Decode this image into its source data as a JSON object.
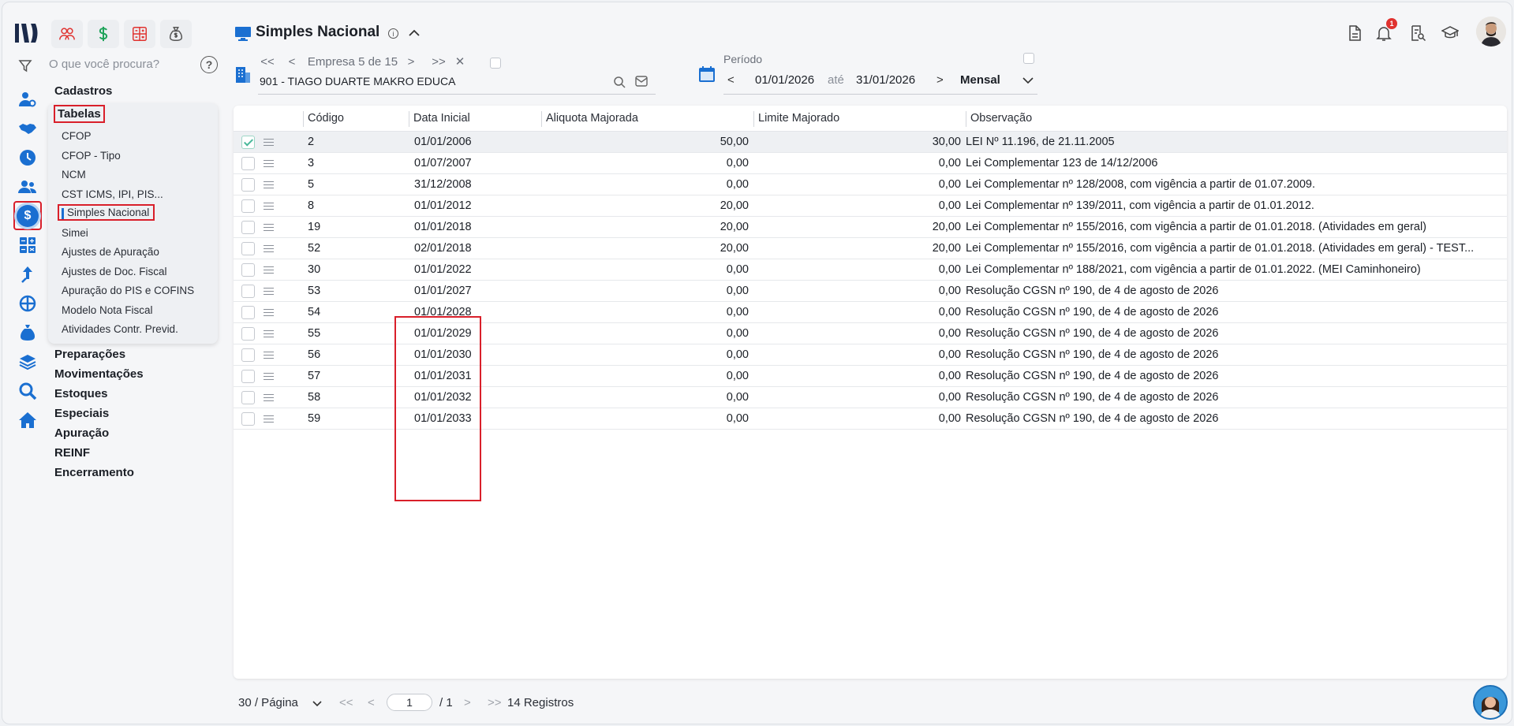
{
  "header": {
    "title": "Simples Nacional",
    "info_icon": "info-icon",
    "collapse_icon": "chevron-up-icon"
  },
  "search": {
    "placeholder": "O que você procura?"
  },
  "modules": [
    "users-icon",
    "dollar-icon",
    "calculator-icon",
    "money-bag-icon"
  ],
  "rail_icons": [
    "user-settings-icon",
    "handshake-icon",
    "clock-icon",
    "people-icon",
    "dollar-circle-icon",
    "grid-icon",
    "arrow-up-icon",
    "network-icon",
    "money-bag-icon",
    "layers-icon",
    "search-icon",
    "home-icon"
  ],
  "menu": {
    "cadastros": "Cadastros",
    "tabelas": "Tabelas",
    "items": [
      "CFOP",
      "CFOP - Tipo",
      "NCM",
      "CST ICMS, IPI, PIS...",
      "Simples Nacional",
      "Simei",
      "Ajustes de Apuração",
      "Ajustes de Doc. Fiscal",
      "Apuração do PIS e COFINS",
      "Modelo Nota Fiscal",
      "Atividades Contr. Previd."
    ],
    "sections": [
      "Preparações",
      "Movimentações",
      "Estoques",
      "Especiais",
      "Apuração",
      "REINF",
      "Encerramento"
    ]
  },
  "empresa": {
    "first": "<<",
    "prev": "<",
    "label": "Empresa 5 de 15",
    "next": ">",
    "last": ">>",
    "close": "✕",
    "name": "901 - TIAGO DUARTE MAKRO EDUCA"
  },
  "periodo": {
    "label": "Período",
    "prev": "<",
    "start": "01/01/2026",
    "ate": "até",
    "end": "31/01/2026",
    "next": ">",
    "mode": "Mensal"
  },
  "notifications": {
    "count": "1"
  },
  "table": {
    "columns": [
      "Código",
      "Data Inicial",
      "Aliquota Majorada",
      "Limite Majorado",
      "Observação"
    ],
    "rows": [
      {
        "codigo": "2",
        "data": "01/01/2006",
        "aliquota": "50,00",
        "limite": "30,00",
        "obs": "LEI Nº 11.196, de 21.11.2005"
      },
      {
        "codigo": "3",
        "data": "01/07/2007",
        "aliquota": "0,00",
        "limite": "0,00",
        "obs": "Lei Complementar 123 de 14/12/2006"
      },
      {
        "codigo": "5",
        "data": "31/12/2008",
        "aliquota": "0,00",
        "limite": "0,00",
        "obs": "Lei Complementar nº 128/2008, com vigência a partir de 01.07.2009."
      },
      {
        "codigo": "8",
        "data": "01/01/2012",
        "aliquota": "20,00",
        "limite": "0,00",
        "obs": "Lei Complementar nº 139/2011, com vigência a partir de 01.01.2012."
      },
      {
        "codigo": "19",
        "data": "01/01/2018",
        "aliquota": "20,00",
        "limite": "20,00",
        "obs": "Lei Complementar nº 155/2016, com vigência a partir de 01.01.2018. (Atividades em geral)"
      },
      {
        "codigo": "52",
        "data": "02/01/2018",
        "aliquota": "20,00",
        "limite": "20,00",
        "obs": "Lei Complementar nº 155/2016, com vigência a partir de 01.01.2018. (Atividades em geral) - TEST..."
      },
      {
        "codigo": "30",
        "data": "01/01/2022",
        "aliquota": "0,00",
        "limite": "0,00",
        "obs": "Lei Complementar nº 188/2021, com vigência a partir de 01.01.2022. (MEI Caminhoneiro)"
      },
      {
        "codigo": "53",
        "data": "01/01/2027",
        "aliquota": "0,00",
        "limite": "0,00",
        "obs": "Resolução CGSN nº 190, de 4 de agosto de 2026"
      },
      {
        "codigo": "54",
        "data": "01/01/2028",
        "aliquota": "0,00",
        "limite": "0,00",
        "obs": "Resolução CGSN nº 190, de 4 de agosto de 2026"
      },
      {
        "codigo": "55",
        "data": "01/01/2029",
        "aliquota": "0,00",
        "limite": "0,00",
        "obs": "Resolução CGSN nº 190, de 4 de agosto de 2026"
      },
      {
        "codigo": "56",
        "data": "01/01/2030",
        "aliquota": "0,00",
        "limite": "0,00",
        "obs": "Resolução CGSN nº 190, de 4 de agosto de 2026"
      },
      {
        "codigo": "57",
        "data": "01/01/2031",
        "aliquota": "0,00",
        "limite": "0,00",
        "obs": "Resolução CGSN nº 190, de 4 de agosto de 2026"
      },
      {
        "codigo": "58",
        "data": "01/01/2032",
        "aliquota": "0,00",
        "limite": "0,00",
        "obs": "Resolução CGSN nº 190, de 4 de agosto de 2026"
      },
      {
        "codigo": "59",
        "data": "01/01/2033",
        "aliquota": "0,00",
        "limite": "0,00",
        "obs": "Resolução CGSN nº 190, de 4 de agosto de 2026"
      }
    ]
  },
  "footer": {
    "page_size": "30 / Página",
    "first": "<<",
    "prev": "<",
    "page": "1",
    "total": "/ 1",
    "next": ">",
    "last": ">>",
    "records": "14 Registros"
  },
  "colors": {
    "accent": "#1a6fd1",
    "highlight": "#d91f2a",
    "badge": "#e0322f"
  }
}
